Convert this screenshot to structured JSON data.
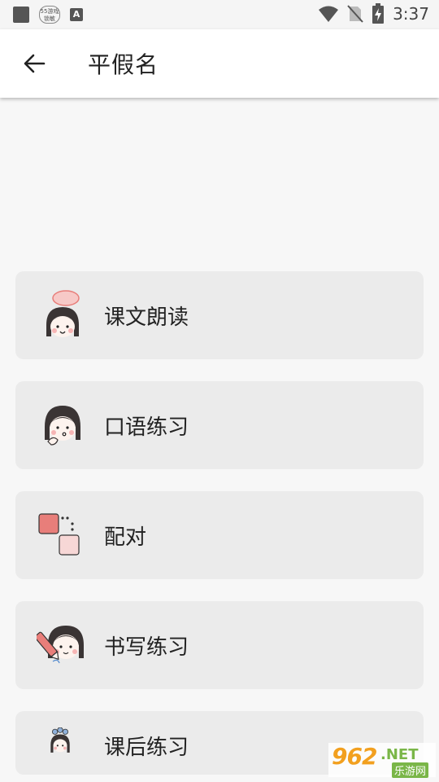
{
  "status_bar": {
    "badge_text": "55游戏\n锁敏",
    "a_icon_text": "A",
    "time": "3:37"
  },
  "app_bar": {
    "title": "平假名"
  },
  "menu": {
    "items": [
      {
        "label": "课文朗读",
        "icon": "girl-speech-bubble-icon"
      },
      {
        "label": "口语练习",
        "icon": "girl-thinking-icon"
      },
      {
        "label": "配对",
        "icon": "matching-squares-icon"
      },
      {
        "label": "书写练习",
        "icon": "girl-pencil-icon"
      },
      {
        "label": "课后练习",
        "icon": "girl-small-icon"
      }
    ]
  },
  "watermark": {
    "number": "962",
    "net": ".NET",
    "cn": "乐游网"
  },
  "colors": {
    "card_bg": "#ebebeb",
    "page_bg": "#f7f7f7",
    "accent_pink": "#e87e7a",
    "hair": "#3a3434"
  }
}
